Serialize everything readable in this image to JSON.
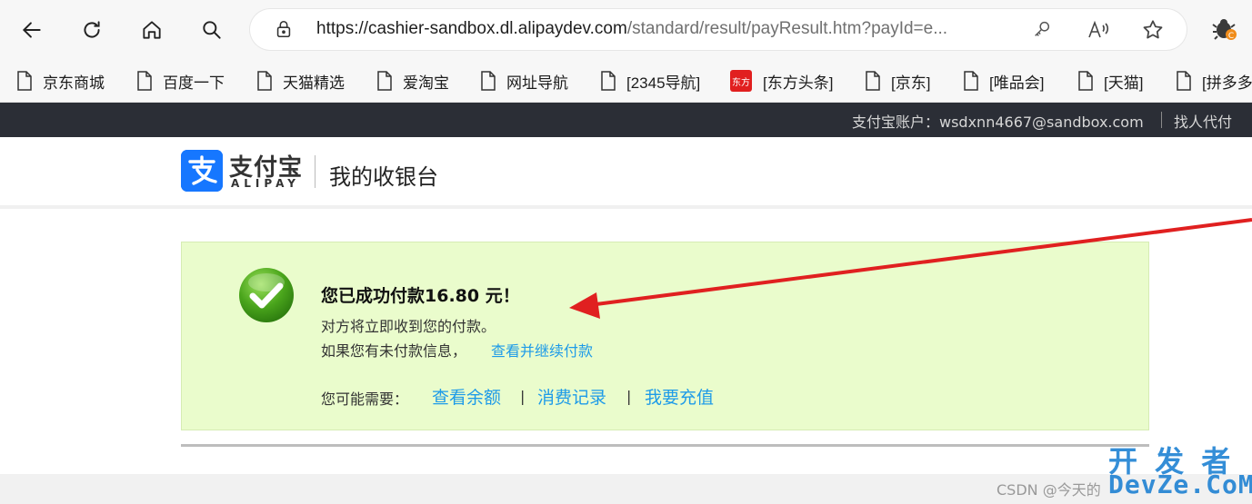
{
  "browser": {
    "url_host": "https://cashier-sandbox.dl.alipaydev.com",
    "url_path": "/standard/result/payResult.htm?payId=e...",
    "icons": [
      "back-icon",
      "refresh-icon",
      "home-icon",
      "search-icon",
      "lock-icon",
      "key-icon",
      "read-aloud-icon",
      "favorite-star-icon",
      "extension-icon"
    ]
  },
  "bookmarks": [
    {
      "label": "京东商城"
    },
    {
      "label": "百度一下"
    },
    {
      "label": "天猫精选"
    },
    {
      "label": "爱淘宝"
    },
    {
      "label": "网址导航"
    },
    {
      "label": "[2345导航]"
    },
    {
      "label": "[东方头条]",
      "badge": "东方"
    },
    {
      "label": "[京东]"
    },
    {
      "label": "[唯品会]"
    },
    {
      "label": "[天猫]"
    },
    {
      "label": "[拼多多"
    }
  ],
  "sitebar": {
    "account": "支付宝账户：wsdxnn4667@sandbox.com",
    "proxy": "找人代付"
  },
  "header": {
    "logo_cn": "支付宝",
    "logo_en": "ALIPAY",
    "title": "我的收银台"
  },
  "result": {
    "title": "您已成功付款16.80 元！",
    "desc": "对方将立即收到您的付款。",
    "unpaid_text": "如果您有未付款信息，",
    "unpaid_link": "查看并继续付款",
    "may_need": "您可能需要：",
    "links": [
      "查看余额",
      "消费记录",
      "我要充值"
    ],
    "separator": "|"
  },
  "colors": {
    "accent": "#1e9be8",
    "success_bg": "#eafccc",
    "sitebar_bg": "#2b2e36",
    "arrow": "#e02020"
  },
  "watermark": {
    "line1": "开 发 者",
    "line2": "DevZe.CoM",
    "csdn": "CSDN @今天的"
  }
}
